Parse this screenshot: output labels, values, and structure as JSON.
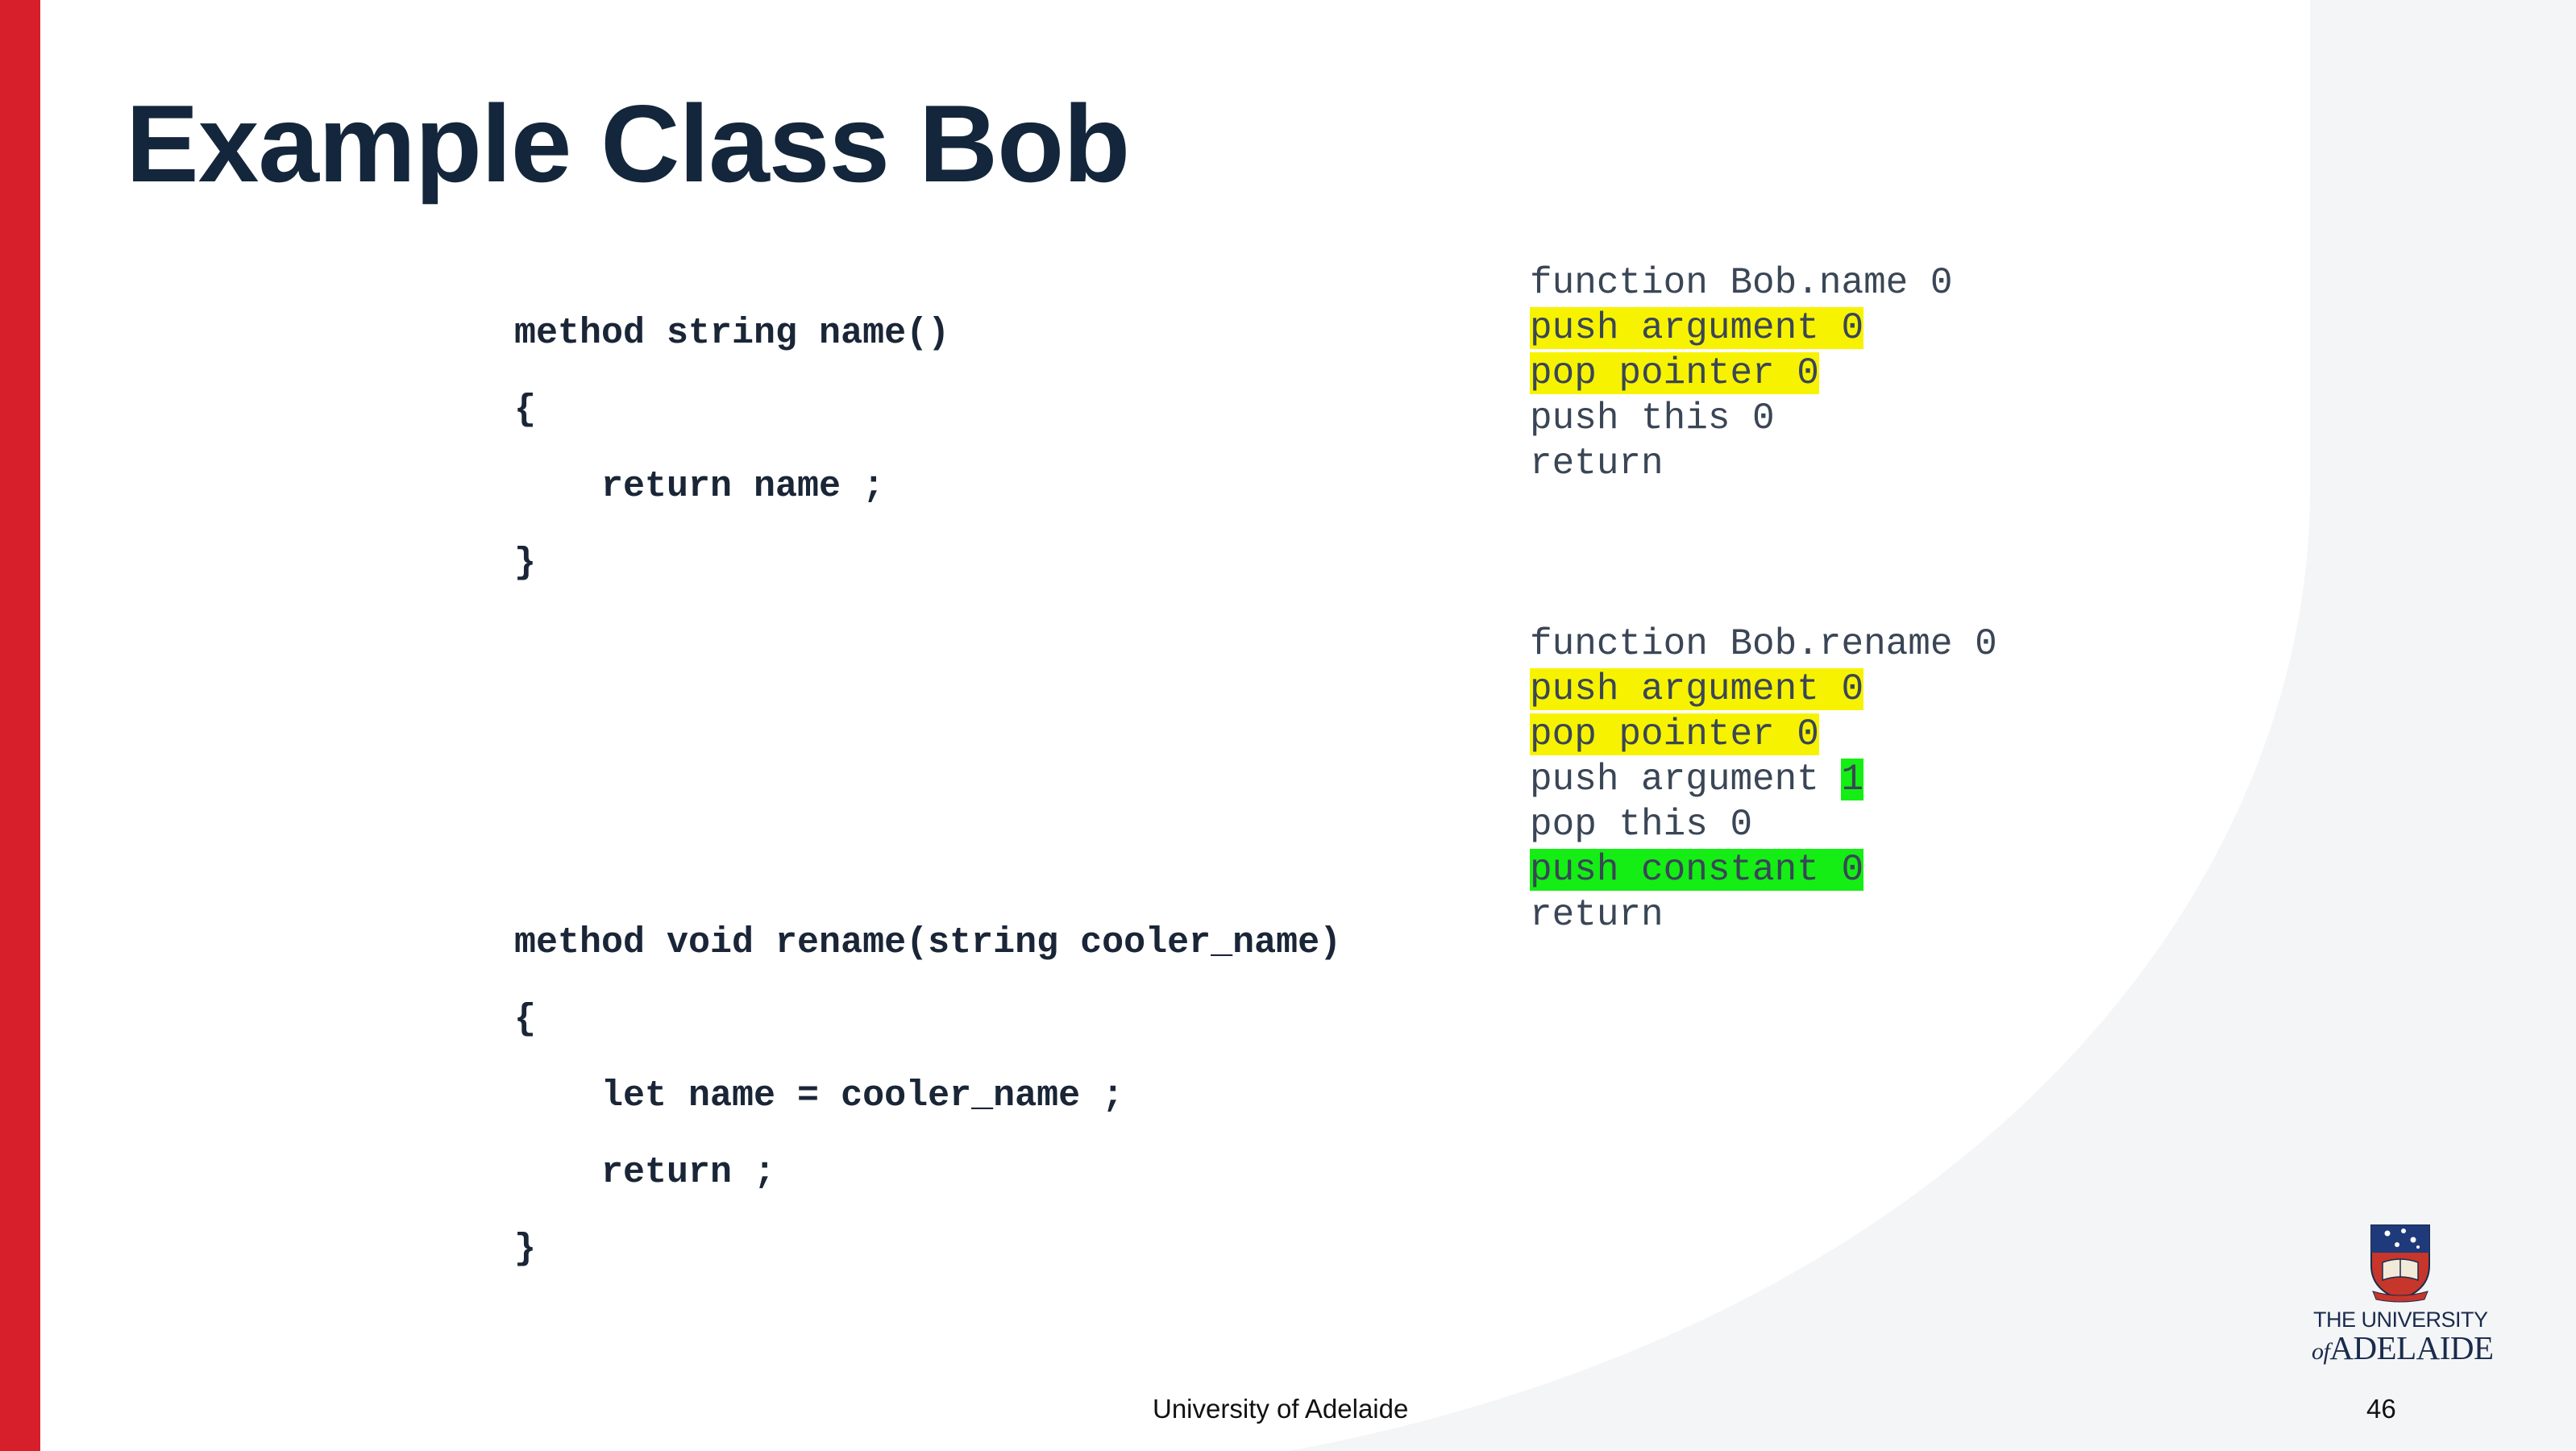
{
  "slide": {
    "title": "Example Class Bob",
    "footer_text": "University of Adelaide",
    "page_number": "46",
    "colors": {
      "accent_bar": "#d61f2b",
      "title": "#14263b",
      "highlight_yellow": "#f7f300",
      "highlight_green": "#14ee14",
      "background_curve": "#f4f5f7"
    }
  },
  "jack_code": {
    "method1": [
      "method string name()",
      "{",
      "    return name ;",
      "}"
    ],
    "method2": [
      "method void rename(string cooler_name)",
      "{",
      "    let name = cooler_name ;",
      "    return ;",
      "}"
    ]
  },
  "vm_code": {
    "name_function": {
      "header": "function Bob.name 0",
      "push_arg": "push argument 0",
      "pop_pointer": "pop pointer 0",
      "push_this": "push this 0",
      "return": "return"
    },
    "rename_function": {
      "header": "function Bob.rename 0",
      "push_arg": "push argument 0",
      "pop_pointer": "pop pointer 0",
      "push_arg1_prefix": "push argument ",
      "push_arg1_index": "1",
      "pop_this": "pop this 0",
      "push_constant": "push constant 0",
      "return": "return"
    }
  },
  "logo": {
    "line1": "THE UNIVERSITY",
    "line2_of": "of",
    "line2_name": "ADELAIDE"
  }
}
